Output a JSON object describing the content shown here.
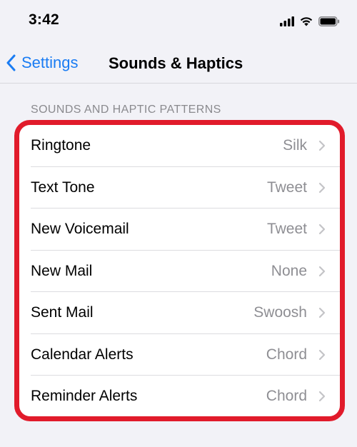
{
  "status_bar": {
    "time": "3:42",
    "icons": [
      "cellular-signal-icon",
      "wifi-icon",
      "battery-icon"
    ]
  },
  "nav": {
    "back_label": "Settings",
    "title": "Sounds & Haptics"
  },
  "section": {
    "header": "SOUNDS AND HAPTIC PATTERNS",
    "highlight_color": "#e11b2b",
    "rows": [
      {
        "label": "Ringtone",
        "value": "Silk"
      },
      {
        "label": "Text Tone",
        "value": "Tweet"
      },
      {
        "label": "New Voicemail",
        "value": "Tweet"
      },
      {
        "label": "New Mail",
        "value": "None"
      },
      {
        "label": "Sent Mail",
        "value": "Swoosh"
      },
      {
        "label": "Calendar Alerts",
        "value": "Chord"
      },
      {
        "label": "Reminder Alerts",
        "value": "Chord"
      }
    ]
  },
  "colors": {
    "accent": "#1a7cf3",
    "background": "#f2f2f7",
    "secondary_text": "#8e8e93"
  }
}
